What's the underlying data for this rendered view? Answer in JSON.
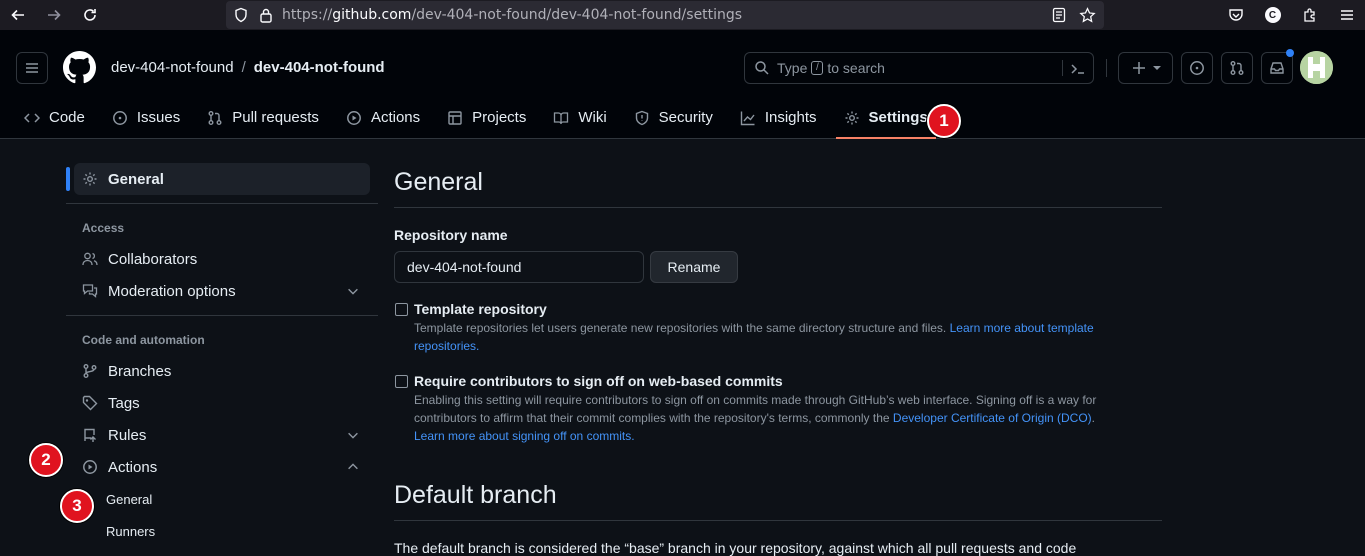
{
  "browser": {
    "url_scheme": "https://",
    "url_host": "github.com",
    "url_path": "/dev-404-not-found/dev-404-not-found/settings",
    "extension_letter": "C"
  },
  "header": {
    "owner": "dev-404-not-found",
    "separator": "/",
    "repo": "dev-404-not-found",
    "search_prefix": "Type",
    "search_key": "/",
    "search_suffix": "to search"
  },
  "tabs": [
    {
      "label": "Code"
    },
    {
      "label": "Issues"
    },
    {
      "label": "Pull requests"
    },
    {
      "label": "Actions"
    },
    {
      "label": "Projects"
    },
    {
      "label": "Wiki"
    },
    {
      "label": "Security"
    },
    {
      "label": "Insights"
    },
    {
      "label": "Settings",
      "active": true
    }
  ],
  "steps": [
    "1",
    "2",
    "3"
  ],
  "sidebar": {
    "general": "General",
    "access_heading": "Access",
    "collaborators": "Collaborators",
    "moderation": "Moderation options",
    "code_heading": "Code and automation",
    "branches": "Branches",
    "tags": "Tags",
    "rules": "Rules",
    "actions": "Actions",
    "actions_general": "General",
    "actions_runners": "Runners"
  },
  "main": {
    "title": "General",
    "repo_name_label": "Repository name",
    "repo_name_value": "dev-404-not-found",
    "rename_button": "Rename",
    "template": {
      "title": "Template repository",
      "desc": "Template repositories let users generate new repositories with the same directory structure and files.",
      "link": "Learn more about template repositories."
    },
    "signoff": {
      "title": "Require contributors to sign off on web-based commits",
      "desc": "Enabling this setting will require contributors to sign off on commits made through GitHub’s web interface. Signing off is a way for contributors to affirm that their commit complies with the repository's terms, commonly the",
      "dco_link": "Developer Certificate of Origin (DCO)",
      "dco_after": ".",
      "learn_link": "Learn more about signing off on commits."
    },
    "default_branch_title": "Default branch",
    "default_branch_text": "The default branch is considered the “base” branch in your repository, against which all pull requests and code"
  },
  "colors": {
    "background": "#0d1117",
    "header": "#010409",
    "accent_tab": "#f78166",
    "link": "#4493f8",
    "step_badge": "#e0131f"
  }
}
